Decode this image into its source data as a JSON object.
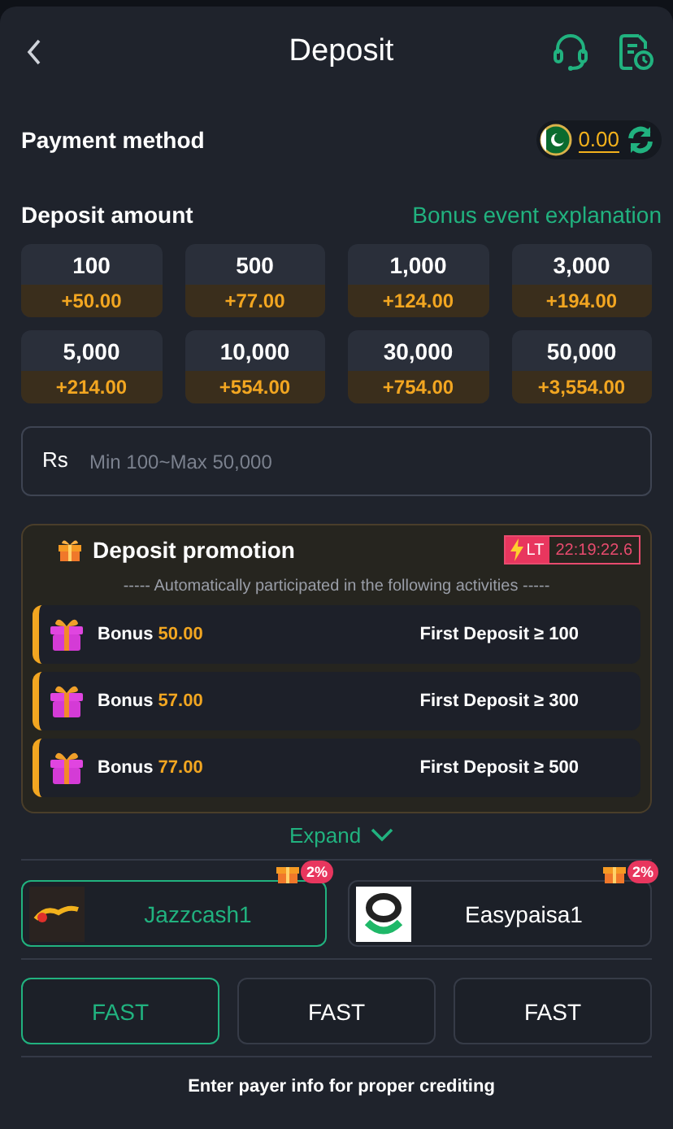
{
  "header": {
    "title": "Deposit"
  },
  "payment_method": {
    "label": "Payment method",
    "balance": "0.00"
  },
  "deposit_amount": {
    "label": "Deposit amount",
    "link": "Bonus event explanation"
  },
  "amounts": [
    {
      "amount": "100",
      "bonus": "+50.00"
    },
    {
      "amount": "500",
      "bonus": "+77.00"
    },
    {
      "amount": "1,000",
      "bonus": "+124.00"
    },
    {
      "amount": "3,000",
      "bonus": "+194.00"
    },
    {
      "amount": "5,000",
      "bonus": "+214.00"
    },
    {
      "amount": "10,000",
      "bonus": "+554.00"
    },
    {
      "amount": "30,000",
      "bonus": "+754.00"
    },
    {
      "amount": "50,000",
      "bonus": "+3,554.00"
    }
  ],
  "amount_field": {
    "currency": "Rs",
    "placeholder": "Min 100~Max 50,000"
  },
  "promotion": {
    "title": "Deposit promotion",
    "timer_tag": "LT",
    "timer": "22:19:22.6",
    "subtitle": "----- Automatically participated in the following activities -----",
    "items": [
      {
        "label": "Bonus",
        "value": "50.00",
        "condition": "First Deposit ≥ 100"
      },
      {
        "label": "Bonus",
        "value": "57.00",
        "condition": "First Deposit ≥ 300"
      },
      {
        "label": "Bonus",
        "value": "77.00",
        "condition": "First Deposit ≥ 500"
      }
    ]
  },
  "expand": "Expand",
  "methods": [
    {
      "name": "Jazzcash1",
      "badge": "2%",
      "kind": "jazzcash",
      "selected": true
    },
    {
      "name": "Easypaisa1",
      "badge": "2%",
      "kind": "easypaisa",
      "selected": false
    }
  ],
  "channels": [
    {
      "label": "FAST",
      "selected": true
    },
    {
      "label": "FAST",
      "selected": false
    },
    {
      "label": "FAST",
      "selected": false
    }
  ],
  "note": "Enter payer info for proper crediting"
}
